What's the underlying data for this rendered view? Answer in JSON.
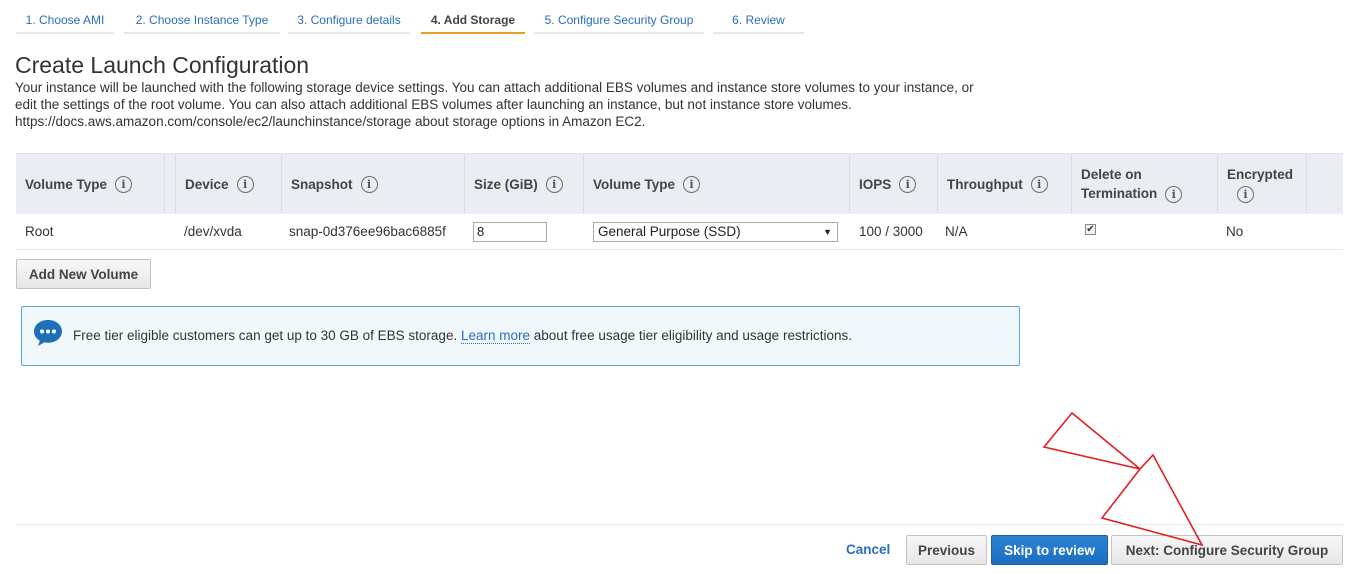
{
  "wizard": {
    "steps": [
      {
        "label": "1. Choose AMI"
      },
      {
        "label": "2. Choose Instance Type"
      },
      {
        "label": "3. Configure details"
      },
      {
        "label": "4. Add Storage"
      },
      {
        "label": "5. Configure Security Group"
      },
      {
        "label": "6. Review"
      }
    ],
    "active_step": 3
  },
  "header": {
    "title": "Create Launch Configuration",
    "description": [
      "Your instance will be launched with the following storage device settings. You can attach additional EBS volumes and instance store volumes to your instance, or",
      "edit the settings of the root volume. You can also attach additional EBS volumes after launching an instance, but not instance store volumes.",
      "https://docs.aws.amazon.com/console/ec2/launchinstance/storage about storage options in Amazon EC2."
    ]
  },
  "table": {
    "columns": [
      {
        "label": "Volume Type"
      },
      {
        "label": "Device"
      },
      {
        "label": "Snapshot"
      },
      {
        "label": "Size (GiB)"
      },
      {
        "label": "Volume Type"
      },
      {
        "label": "IOPS"
      },
      {
        "label": "Throughput"
      },
      {
        "label_line1": "Delete on",
        "label_line2": "Termination"
      },
      {
        "label": "Encrypted"
      }
    ],
    "rows": [
      {
        "volume_type": "Root",
        "device": "/dev/xvda",
        "snapshot": "snap-0d376ee96bac6885f",
        "size": "8",
        "ebs_volume_type": "General Purpose (SSD)",
        "iops": "100 / 3000",
        "throughput": "N/A",
        "delete_on_termination": true,
        "encrypted": "No"
      }
    ]
  },
  "add_volume_label": "Add New Volume",
  "info": {
    "text_before": "Free tier eligible customers can get up to 30 GB of EBS storage.",
    "link": "Learn more",
    "text_after": "about free usage tier eligibility and usage restrictions."
  },
  "footer": {
    "cancel": "Cancel",
    "previous": "Previous",
    "skip": "Skip to review",
    "next": "Next: Configure Security Group"
  },
  "colors": {
    "link": "#2a6ebb",
    "active_tab_underline": "#eb9d2a",
    "primary_button": "#1f74c6",
    "annotation_arrow": "#e02020"
  },
  "icons": {
    "info": "info-circle-icon",
    "chat": "chat-bubble-icon",
    "dropdown": "caret-down-icon",
    "check": "checkmark-icon"
  }
}
